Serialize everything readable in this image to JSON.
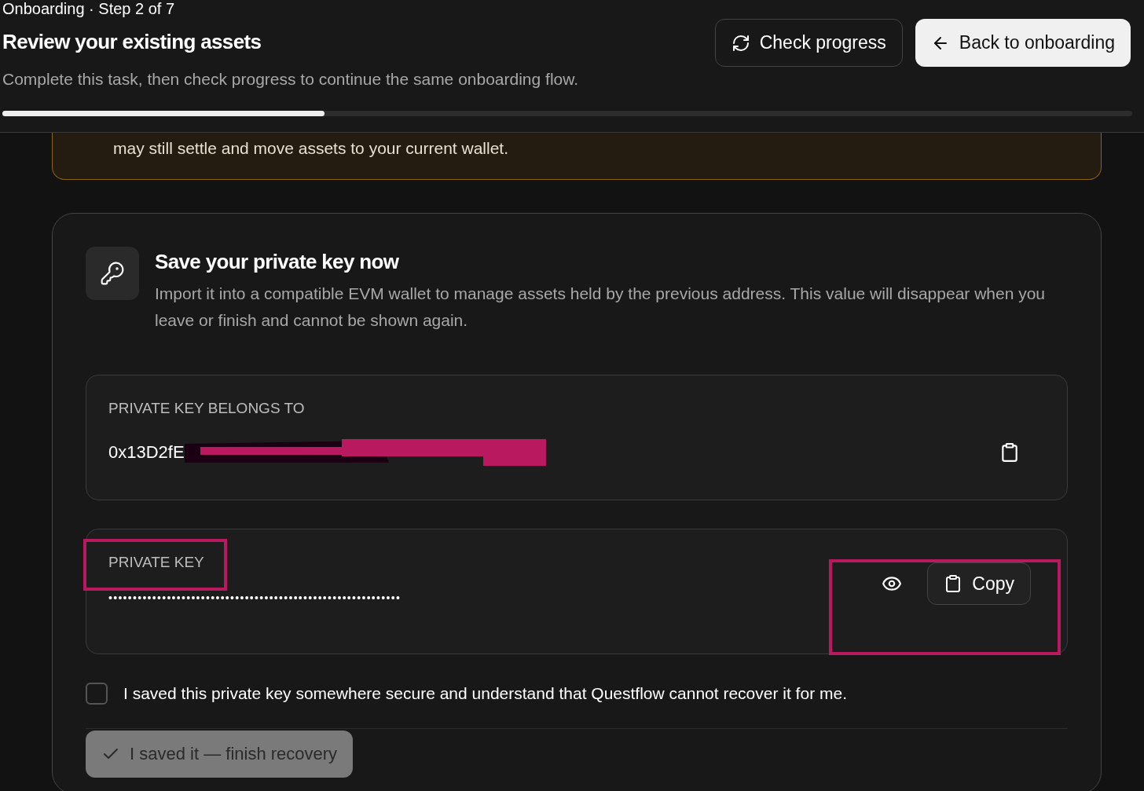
{
  "header": {
    "step": "Onboarding · Step 2 of 7",
    "title": "Review your existing assets",
    "subtitle": "Complete this task, then check progress to continue the same onboarding flow.",
    "progress": {
      "level": 0.285
    },
    "buttons": [
      {
        "label": "Check progress",
        "kind": "secondary"
      },
      {
        "label": "Back to onboarding",
        "kind": "primary"
      }
    ]
  },
  "warning": {
    "text": "may still settle and move assets to your current wallet."
  },
  "card": {
    "title": "Save your private key now",
    "description": "Import it into a compatible EVM wallet to manage assets held by the previous address. This value will disappear when you leave or finish and cannot be shown again.",
    "owner": {
      "label": "PRIVATE KEY BELONGS TO",
      "value": "0x13D2fE",
      "redacted": true
    },
    "key": {
      "label": "PRIVATE KEY",
      "value": "••••••••••••••••••••••••••••••••••••••••••••••••••••••••••••",
      "copy": "Copy",
      "highlighted": true
    },
    "confirm": {
      "text": "I saved this private key somewhere secure and understand that Questflow cannot recover it for me.",
      "checked": false
    },
    "finish": {
      "label": "I saved it — finish recovery",
      "disabled": true
    }
  }
}
